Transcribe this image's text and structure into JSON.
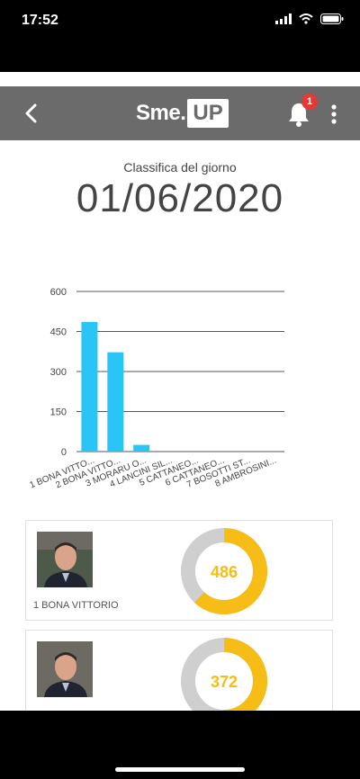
{
  "status": {
    "time": "17:52"
  },
  "header": {
    "logo_left": "Sme.",
    "logo_right": "UP",
    "notification_count": "1"
  },
  "page": {
    "subtitle": "Classifica del giorno",
    "date": "01/06/2020"
  },
  "chart_data": {
    "type": "bar",
    "categories": [
      "1 BONA VITTO...",
      "2 BONA VITTO...",
      "3 MORARU O...",
      "4 LANCINI SIL...",
      "5 CATTANEO...",
      "6 CATTANEO...",
      "7 BOSOTTI ST...",
      "8 AMBROSINI..."
    ],
    "values": [
      486,
      372,
      25,
      0,
      0,
      0,
      0,
      0
    ],
    "yticks": [
      "0",
      "150",
      "300",
      "450",
      "600"
    ],
    "ylim": [
      0,
      600
    ],
    "color": "#29c5f6",
    "grid": true
  },
  "cards": [
    {
      "name": "1 BONA VITTORIO",
      "score": "486",
      "fraction": 0.62
    },
    {
      "name": "",
      "score": "372",
      "fraction": 0.5
    }
  ],
  "colors": {
    "donut_fill": "#f6bd16",
    "donut_track": "#cfcfcf"
  }
}
